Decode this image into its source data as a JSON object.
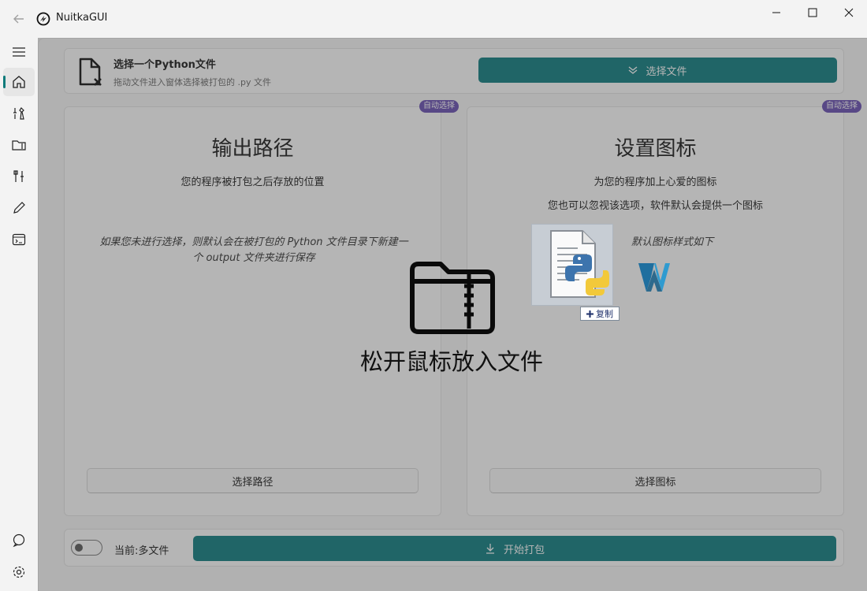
{
  "app": {
    "title": "NuitkaGUI"
  },
  "window_controls": {
    "minimize": "minimize",
    "maximize": "maximize",
    "close": "close"
  },
  "sidebar": {
    "items": [
      {
        "icon": "menu-icon"
      },
      {
        "icon": "home-icon",
        "active": true
      },
      {
        "icon": "tools-icon"
      },
      {
        "icon": "folder-icon"
      },
      {
        "icon": "wrench-icon"
      },
      {
        "icon": "pencil-icon"
      },
      {
        "icon": "terminal-icon"
      }
    ],
    "bottom": [
      {
        "icon": "chat-icon"
      },
      {
        "icon": "gear-icon"
      }
    ]
  },
  "file_select": {
    "title": "选择一个Python文件",
    "subtitle": "拖动文件进入窗体选择被打包的 .py 文件",
    "button_label": "选择文件"
  },
  "output_panel": {
    "badge": "自动选择",
    "title": "输出路径",
    "description": "您的程序被打包之后存放的位置",
    "note_line1": "如果您未进行选择，则默认会在被打包的 Python 文件目录下新建一",
    "note_line2": "个 output 文件夹进行保存",
    "button_label": "选择路径"
  },
  "icon_panel": {
    "badge": "自动选择",
    "title": "设置图标",
    "description1": "为您的程序加上心爱的图标",
    "description2": "您也可以忽视该选项，软件默认会提供一个图标",
    "default_note": "默认图标样式如下",
    "button_label": "选择图标"
  },
  "bottom_bar": {
    "toggle_label": "当前:多文件",
    "start_button": "开始打包"
  },
  "drop_overlay": {
    "text": "松开鼠标放入文件",
    "copy_label": "复制"
  },
  "colors": {
    "accent": "#0f7f82",
    "badge": "#6a4fb4"
  }
}
